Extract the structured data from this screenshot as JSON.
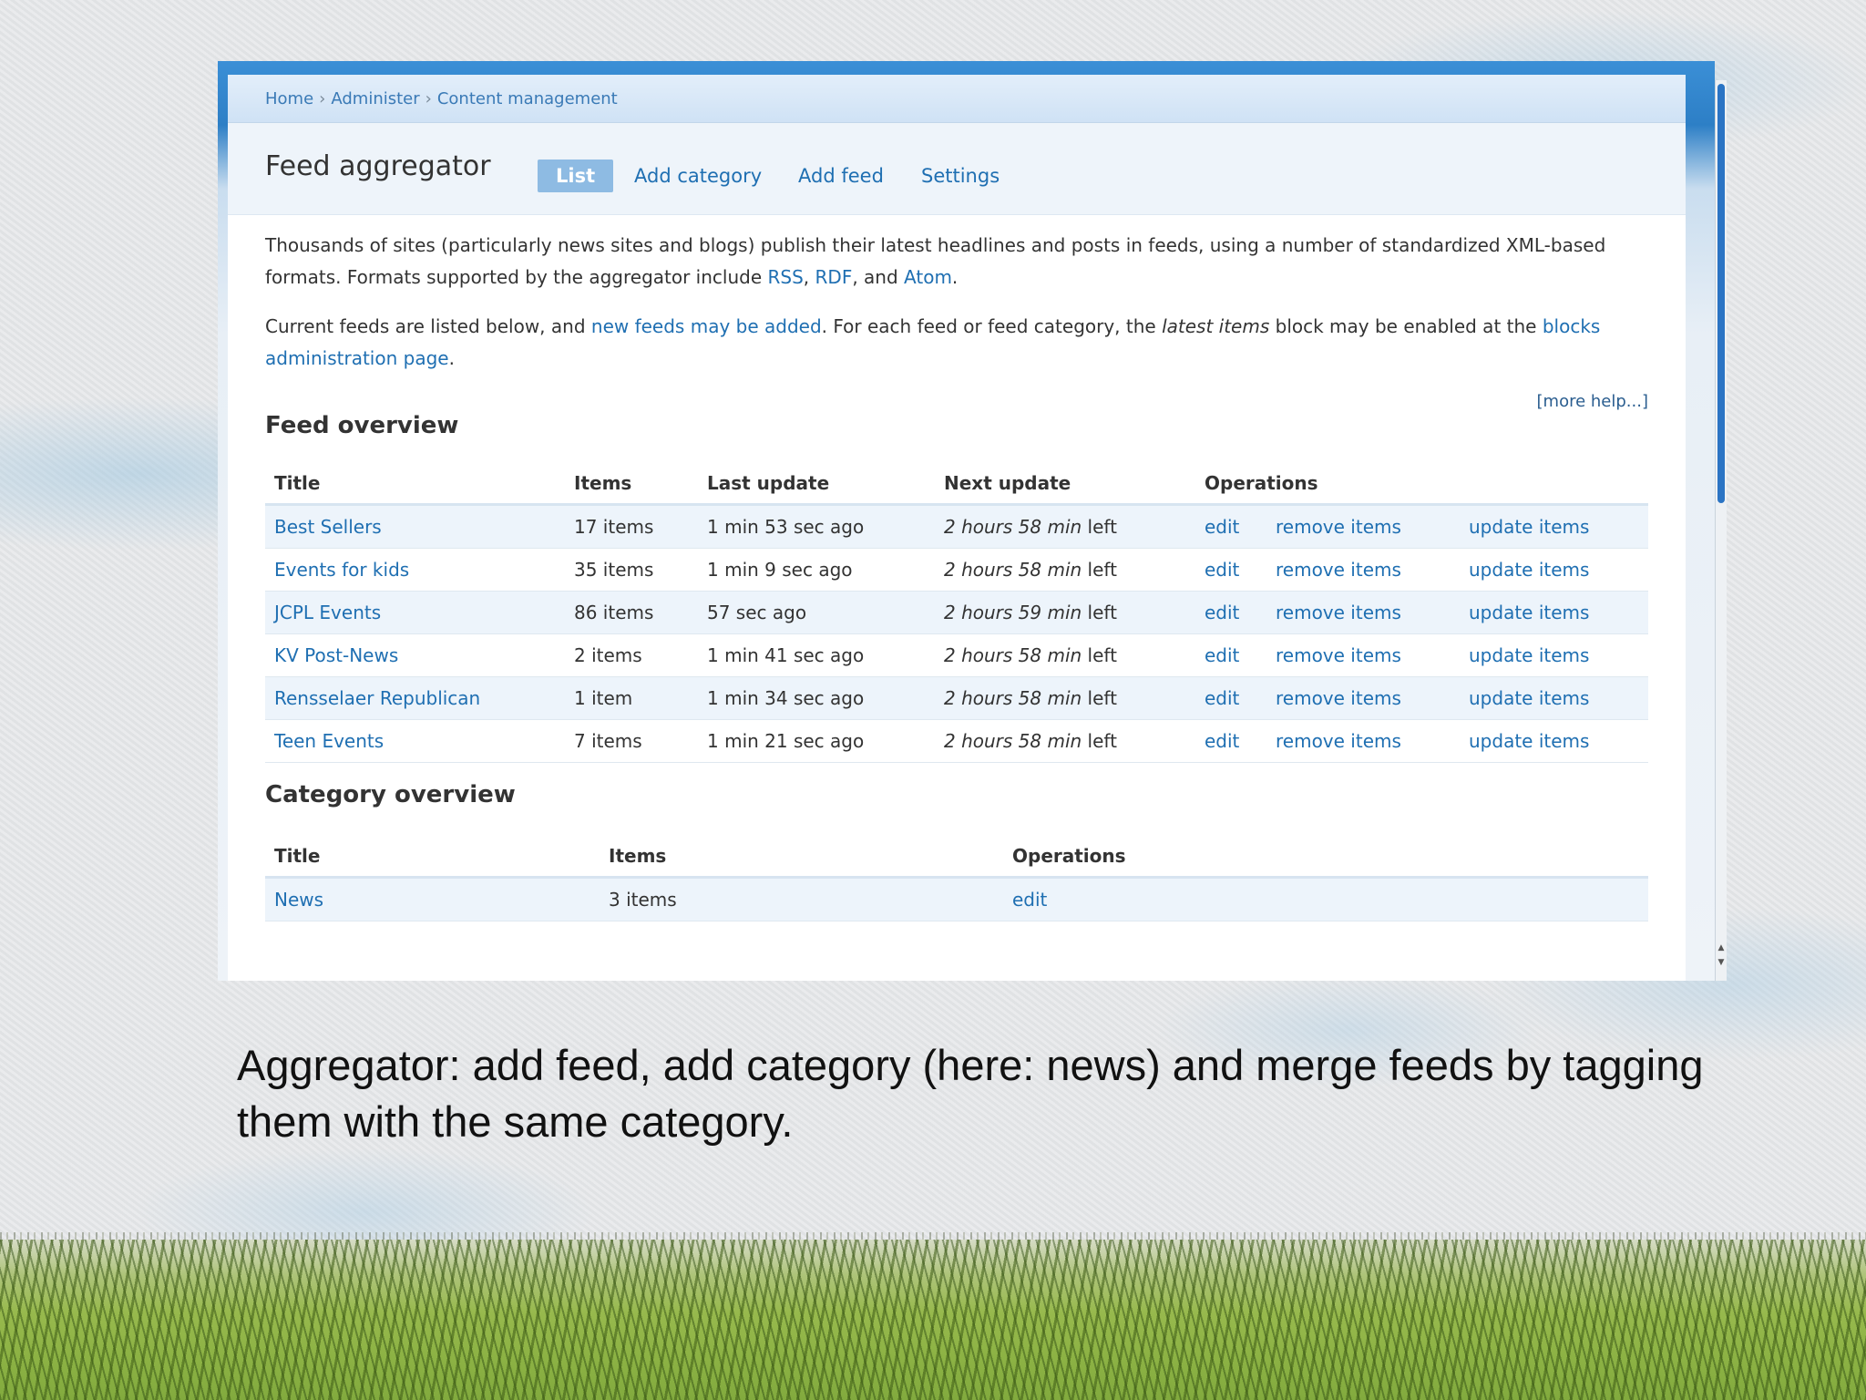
{
  "breadcrumb": [
    "Home",
    "Administer",
    "Content management"
  ],
  "breadcrumb_separator": "›",
  "page_title": "Feed aggregator",
  "tabs": {
    "list": "List",
    "add_category": "Add category",
    "add_feed": "Add feed",
    "settings": "Settings"
  },
  "intro": {
    "p1_text": "Thousands of sites (particularly news sites and blogs) publish their latest headlines and posts in feeds, using a number of standardized XML-based formats. Formats supported by the aggregator include ",
    "p1_rss": "RSS",
    "p1_comma1": ", ",
    "p1_rdf": "RDF",
    "p1_and": ", and ",
    "p1_atom": "Atom",
    "p1_end": ".",
    "p2_start": "Current feeds are listed below, and ",
    "p2_link1": "new feeds may be added",
    "p2_mid": ". For each feed or feed category, the ",
    "p2_em": "latest items",
    "p2_mid2": " block may be enabled at the ",
    "p2_link2": "blocks administration page",
    "p2_end": "."
  },
  "more_help": "[more help...]",
  "feed_overview": {
    "title": "Feed overview",
    "headers": [
      "Title",
      "Items",
      "Last update",
      "Next update",
      "Operations"
    ],
    "rows": [
      {
        "title": "Best Sellers",
        "items": "17 items",
        "last_update": "1 min 53 sec ago",
        "next_update_em": "2 hours 58 min",
        "next_update_suffix": " left",
        "op_edit": "edit",
        "op_remove": "remove items",
        "op_update": "update items"
      },
      {
        "title": "Events for kids",
        "items": "35 items",
        "last_update": "1 min 9 sec ago",
        "next_update_em": "2 hours 58 min",
        "next_update_suffix": " left",
        "op_edit": "edit",
        "op_remove": "remove items",
        "op_update": "update items"
      },
      {
        "title": "JCPL Events",
        "items": "86 items",
        "last_update": "57 sec ago",
        "next_update_em": "2 hours 59 min",
        "next_update_suffix": " left",
        "op_edit": "edit",
        "op_remove": "remove items",
        "op_update": "update items"
      },
      {
        "title": "KV Post-News",
        "items": "2 items",
        "last_update": "1 min 41 sec ago",
        "next_update_em": "2 hours 58 min",
        "next_update_suffix": " left",
        "op_edit": "edit",
        "op_remove": "remove items",
        "op_update": "update items"
      },
      {
        "title": "Rensselaer Republican",
        "items": "1 item",
        "last_update": "1 min 34 sec ago",
        "next_update_em": "2 hours 58 min",
        "next_update_suffix": " left",
        "op_edit": "edit",
        "op_remove": "remove items",
        "op_update": "update items"
      },
      {
        "title": "Teen Events",
        "items": "7 items",
        "last_update": "1 min 21 sec ago",
        "next_update_em": "2 hours 58 min",
        "next_update_suffix": " left",
        "op_edit": "edit",
        "op_remove": "remove items",
        "op_update": "update items"
      }
    ]
  },
  "category_overview": {
    "title": "Category overview",
    "headers": [
      "Title",
      "Items",
      "Operations"
    ],
    "rows": [
      {
        "title": "News",
        "items": "3 items",
        "op_edit": "edit"
      }
    ]
  },
  "scrollbar": {
    "arrow_up": "▲",
    "arrow_down": "▼"
  },
  "caption": "Aggregator: add feed, add category (here: news) and merge feeds by tagging them with the same category.",
  "colors": {
    "link": "#1f6fb2",
    "active_tab": "#8ebbe3",
    "header_blue": "#2d7fc6",
    "row_alt": "#edf4fb"
  }
}
